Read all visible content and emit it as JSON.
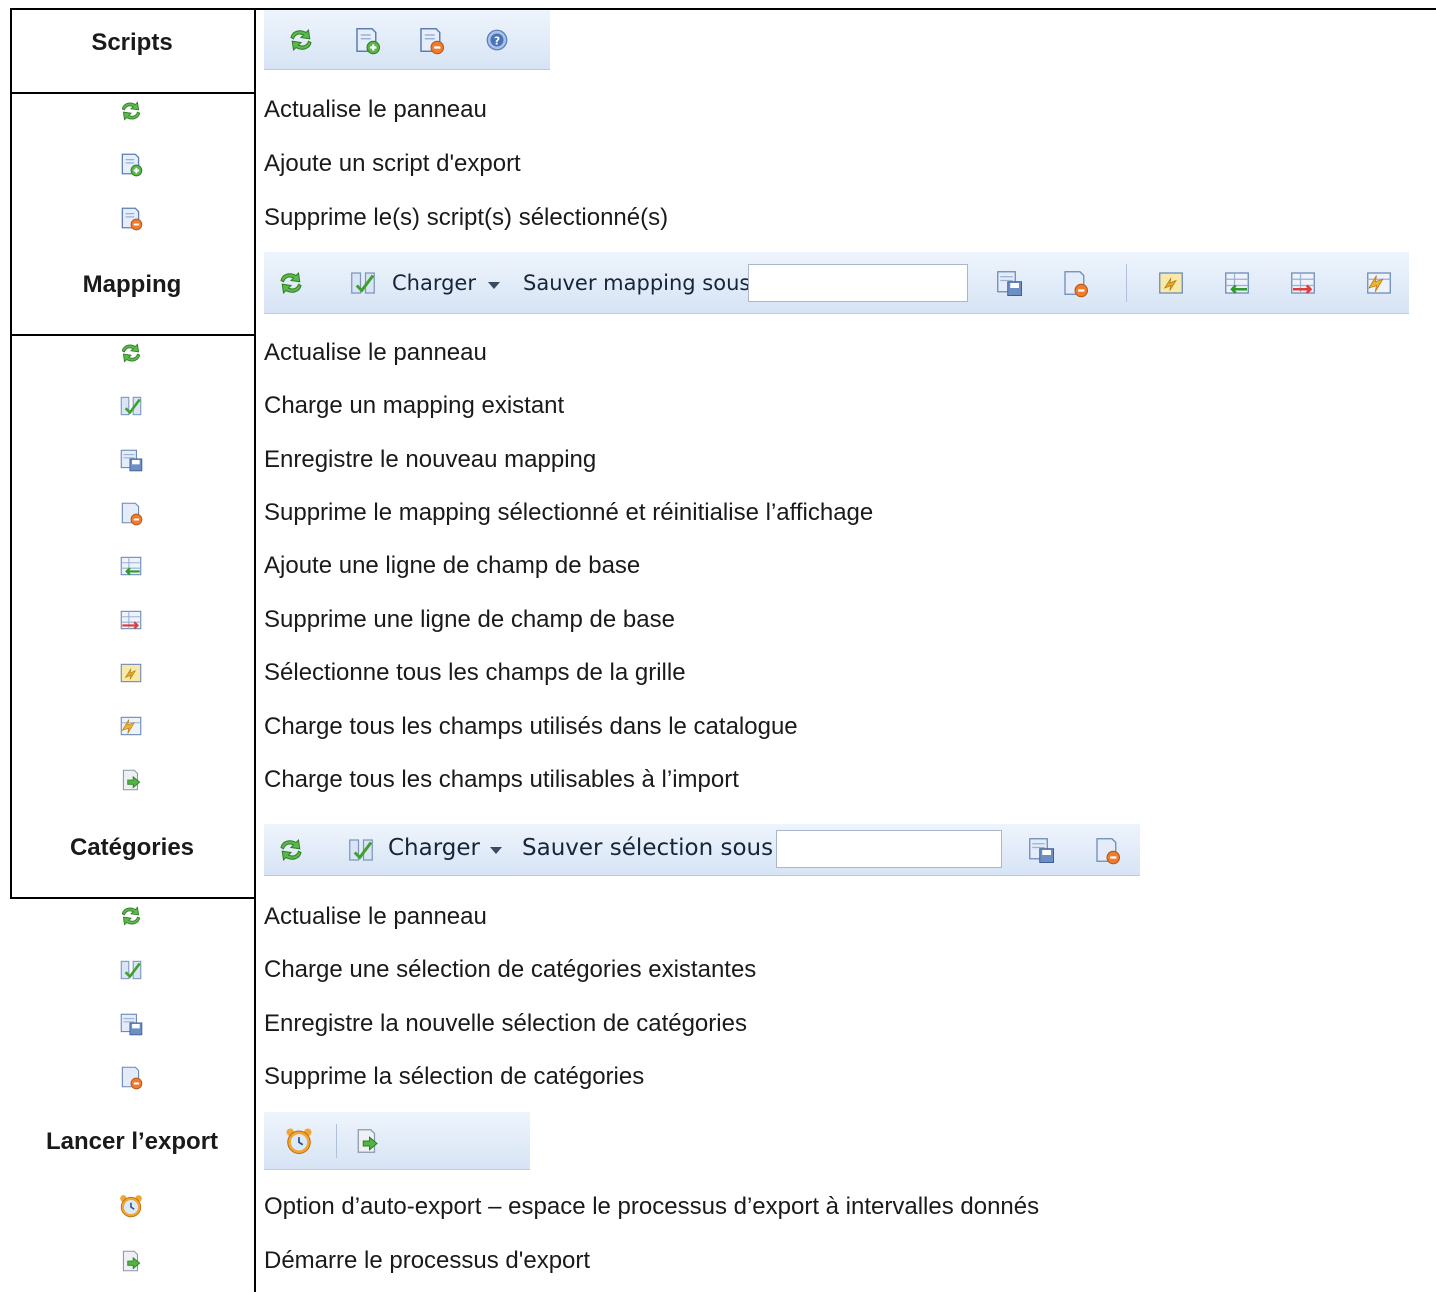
{
  "sections": {
    "scripts": "Scripts",
    "mapping": "Mapping",
    "categories": "Catégories",
    "export": "Lancer l’export"
  },
  "scripts_rows": [
    "Actualise le panneau",
    "Ajoute un script d'export",
    "Supprime le(s) script(s) sélectionné(s)"
  ],
  "mapping_toolbar": {
    "load_label": "Charger",
    "save_as_label": "Sauver mapping sous",
    "save_as_value": ""
  },
  "mapping_rows": [
    "Actualise le panneau",
    "Charge un mapping existant",
    "Enregistre le nouveau mapping",
    "Supprime le mapping sélectionné et réinitialise l’affichage",
    "Ajoute une ligne de champ de base",
    "Supprime une ligne de champ de base",
    "Sélectionne tous les champs de la grille",
    "Charge tous les champs utilisés dans le catalogue",
    "Charge tous les champs utilisables à l’import"
  ],
  "categories_toolbar": {
    "load_label": "Charger",
    "save_as_label": "Sauver sélection sous",
    "save_as_value": ""
  },
  "categories_rows": [
    "Actualise le panneau",
    "Charge une sélection de catégories existantes",
    "Enregistre la nouvelle sélection de catégories",
    "Supprime la sélection de catégories"
  ],
  "export_rows": [
    "Option d’auto-export – espace le processus d’export à intervalles donnés",
    "Démarre le processus d'export"
  ],
  "icons": [
    "refresh-icon",
    "add-script-icon",
    "remove-script-icon",
    "help-icon",
    "load-mapping-icon",
    "save-icon",
    "delete-icon",
    "select-all-icon",
    "add-row-icon",
    "remove-row-icon",
    "load-used-fields-icon",
    "load-import-fields-icon",
    "alarm-clock-icon",
    "start-export-icon"
  ],
  "colors": {
    "toolbar_top": "#eef4fc",
    "toolbar_bottom": "#d7e4f5",
    "refresh_green": "#4caf3a"
  }
}
